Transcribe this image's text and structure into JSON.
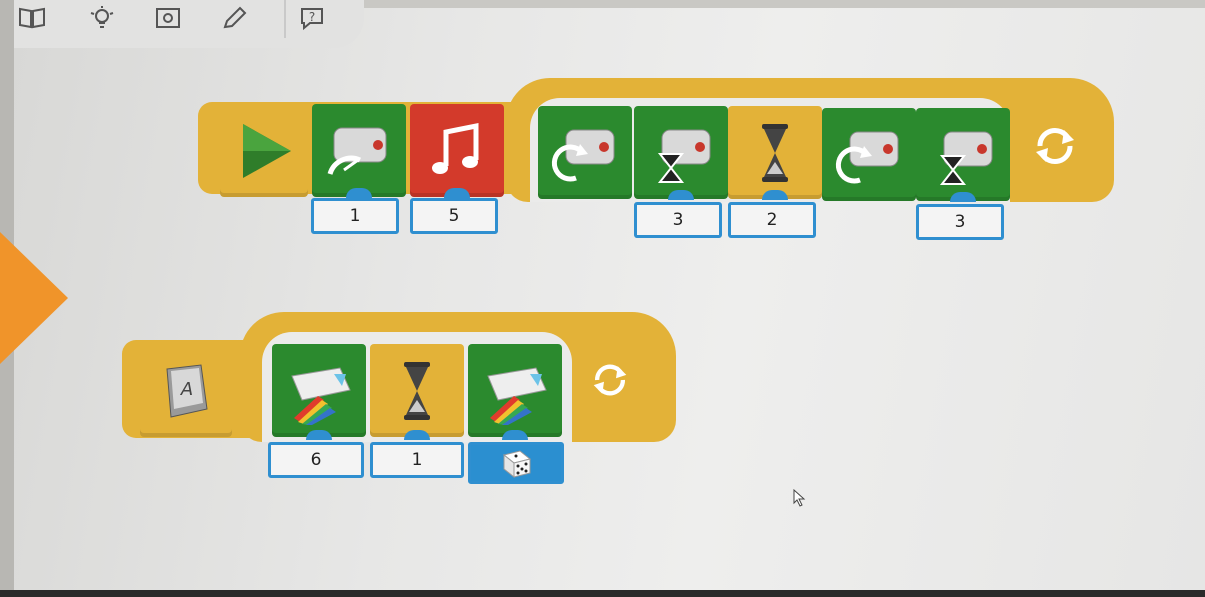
{
  "toolbar": {
    "icons": [
      "book-icon",
      "lightbulb-icon",
      "camera-icon",
      "pencil-icon",
      "help-icon"
    ],
    "help_glyph": "?"
  },
  "program1": {
    "start_icon": "play-icon",
    "blocks": [
      {
        "name": "motor-power-block",
        "icon": "motor-speedometer-icon",
        "color": "green",
        "input": "1"
      },
      {
        "name": "sound-block",
        "icon": "music-note-icon",
        "color": "red",
        "input": "5"
      },
      {
        "name": "motor-clockwise-block",
        "icon": "motor-rotate-icon",
        "color": "green",
        "input": null
      },
      {
        "name": "motor-on-for-block",
        "icon": "motor-hourglass-icon",
        "color": "green",
        "input": "3"
      },
      {
        "name": "wait-block",
        "icon": "hourglass-icon",
        "color": "yellow",
        "input": "2"
      },
      {
        "name": "motor-clockwise-block-2",
        "icon": "motor-rotate-icon",
        "color": "green",
        "input": null
      },
      {
        "name": "motor-on-for-block-2",
        "icon": "motor-hourglass-icon",
        "color": "green",
        "input": "3"
      }
    ],
    "loop_icon": "repeat-icon"
  },
  "program2": {
    "start_icon": "key-a-icon",
    "key_label": "A",
    "blocks": [
      {
        "name": "light-color-block",
        "icon": "hub-rainbow-icon",
        "color": "green",
        "input": "6"
      },
      {
        "name": "wait-block-2",
        "icon": "hourglass-icon",
        "color": "yellow",
        "input": "1"
      },
      {
        "name": "light-color-block-2",
        "icon": "hub-rainbow-icon",
        "color": "green",
        "input": "random"
      }
    ],
    "random_icon": "dice-icon",
    "loop_icon": "repeat-icon"
  },
  "colors": {
    "block_green": "#2b8a2e",
    "block_red": "#d33a2b",
    "block_yellow": "#e3b238",
    "input_blue": "#2f8fd0",
    "nav_orange": "#f0942a"
  }
}
